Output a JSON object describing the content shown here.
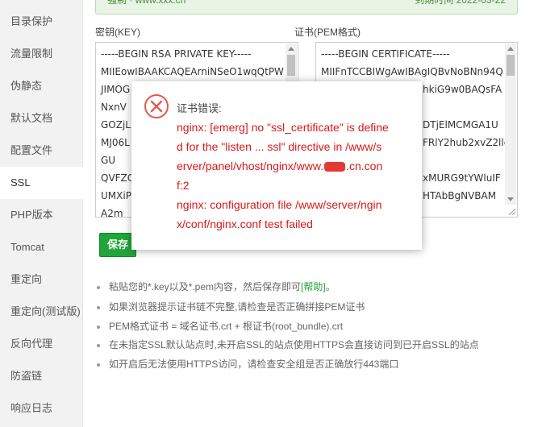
{
  "banner": {
    "left": "强制 · www.xxx.cn",
    "right": "到期时间 2022-03-22"
  },
  "sidebar": {
    "items": [
      {
        "label": "目录保护"
      },
      {
        "label": "流量限制"
      },
      {
        "label": "伪静态"
      },
      {
        "label": "默认文档"
      },
      {
        "label": "配置文件"
      },
      {
        "label": "SSL"
      },
      {
        "label": "PHP版本"
      },
      {
        "label": "Tomcat"
      },
      {
        "label": "重定向"
      },
      {
        "label": "重定向(测试版)"
      },
      {
        "label": "反向代理"
      },
      {
        "label": "防盗链"
      },
      {
        "label": "响应日志"
      }
    ],
    "active_index": 5
  },
  "form": {
    "key_label": "密钥(KEY)",
    "pem_label": "证书(PEM格式)",
    "key_lines": [
      "-----BEGIN RSA PRIVATE KEY-----",
      "MIIEowIBAAKCAQEArniNSeO1wqQtPW",
      "JIMOG",
      "NxnV",
      "GOZjL",
      "MJ06L",
      "GU",
      "QVFZC",
      "UMXiP",
      "A2m"
    ],
    "pem_lines": [
      "-----BEGIN CERTIFICATE-----",
      "MIIFnTCCBIWgAwIBAgIQBvNoBNn94Q",
      "hkiG9w0BAQsFA",
      "",
      "DTjElMCMGA1U",
      "FRlY2hub2xvZ2llc",
      "",
      "xMURG9tYWluIF",
      "HTAbBgNVBAM",
      ""
    ],
    "save_label": "保存"
  },
  "tips": [
    {
      "text": "粘贴您的*.key以及*.pem内容，然后保存即可",
      "help": "[帮助]",
      "end": "。"
    },
    {
      "text": "如果浏览器提示证书链不完整,请检查是否正确拼接PEM证书"
    },
    {
      "text": "PEM格式证书 = 域名证书.crt + 根证书(root_bundle).crt"
    },
    {
      "text": "在未指定SSL默认站点时,未开启SSL的站点使用HTTPS会直接访问到已开启SSL的站点"
    },
    {
      "text": "如开启后无法使用HTTPS访问，请检查安全组是否正确放行443端口"
    }
  ],
  "dialog": {
    "title": "证书错误:",
    "lines": [
      "nginx: [emerg] no \"ssl_certificate\" is define",
      "d for the \"listen ... ssl\" directive in /www/s",
      "erver/panel/vhost/nginx/www.",
      ".cn.con",
      "f:2",
      "nginx: configuration file /www/server/ngin",
      "x/conf/nginx.conf test failed"
    ],
    "icon": "error-circle-x-icon",
    "color": "#d81919"
  }
}
